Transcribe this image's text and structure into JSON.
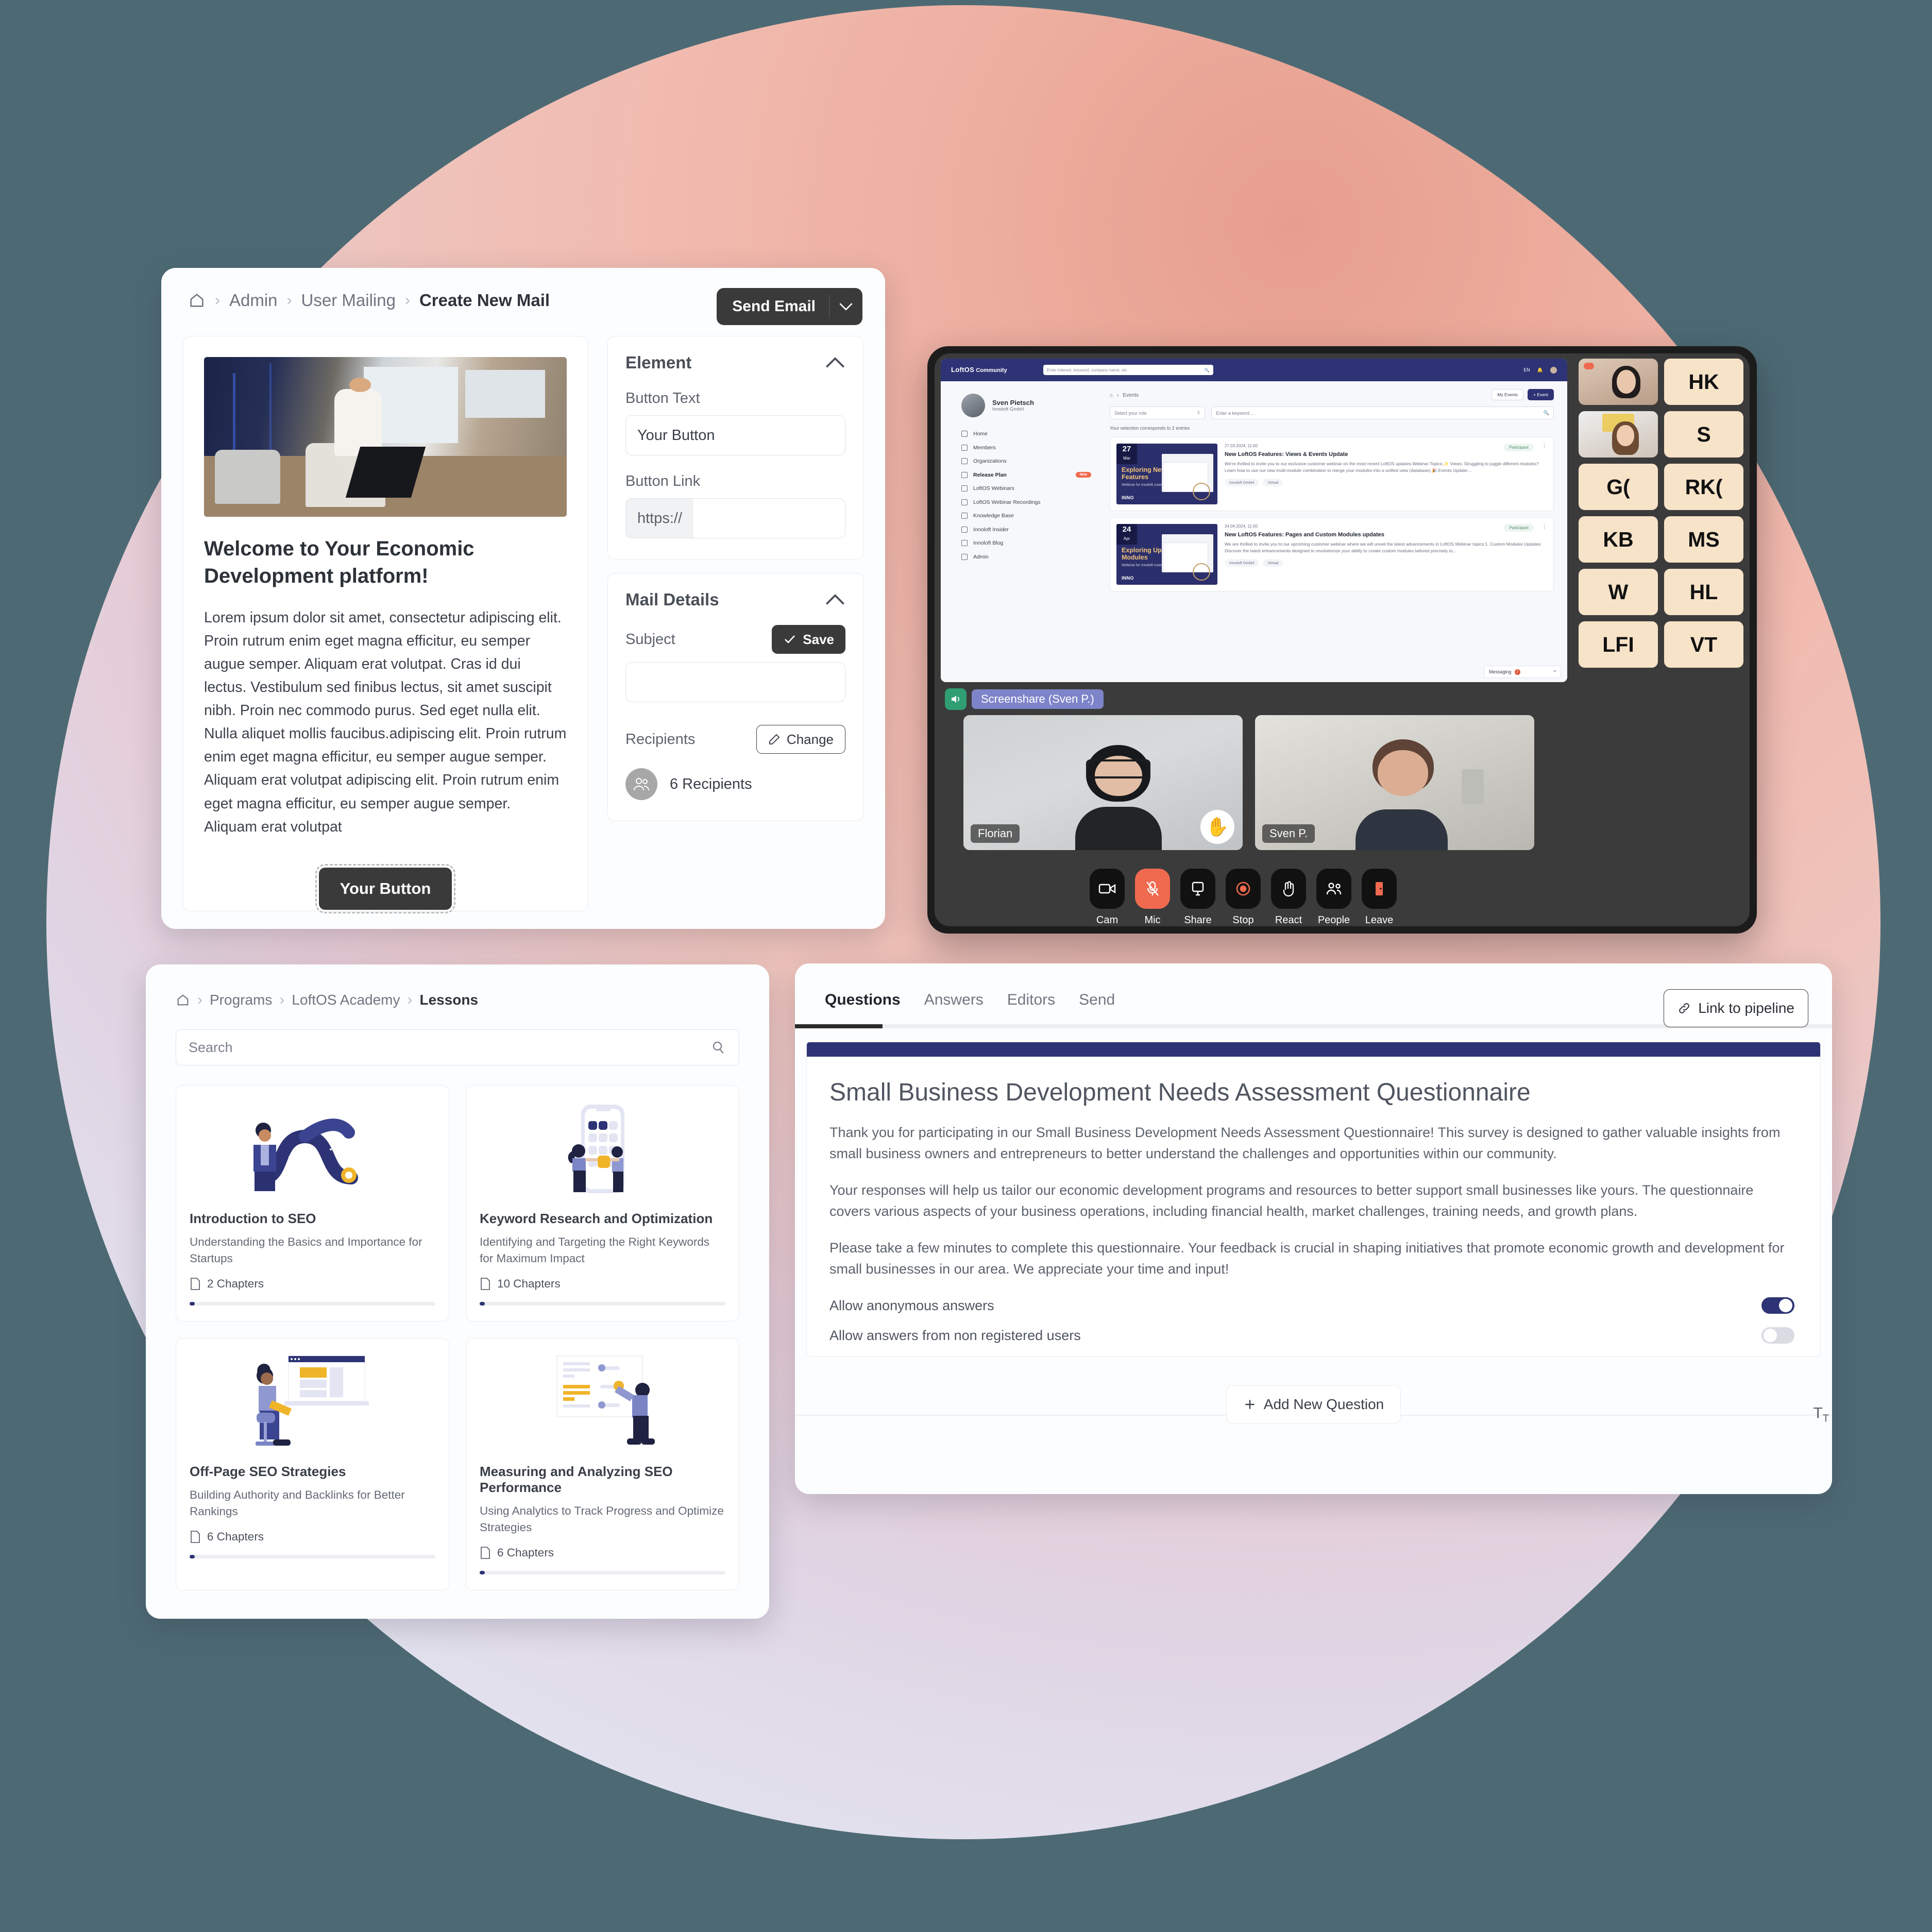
{
  "background": {
    "teal": "#4d6a74",
    "blob_pink": "#eeb0a2",
    "blob_lavender": "#e3e2ef"
  },
  "mail": {
    "breadcrumb": [
      "Admin",
      "User Mailing",
      "Create New Mail"
    ],
    "send_button": "Send Email",
    "preview": {
      "title": "Welcome to Your Economic Development platform!",
      "body": "Lorem ipsum dolor sit amet, consectetur adipiscing elit. Proin rutrum enim eget magna efficitur, eu semper augue semper. Aliquam erat volutpat. Cras id dui lectus. Vestibulum sed finibus lectus, sit amet suscipit nibh. Proin nec commodo purus. Sed eget nulla elit. Nulla aliquet mollis faucibus.adipiscing elit. Proin rutrum enim eget magna efficitur, eu semper augue semper. Aliquam erat volutpat adipiscing elit. Proin rutrum enim eget magna efficitur, eu semper augue semper. Aliquam erat volutpat",
      "button": "Your Button"
    },
    "element_panel": {
      "title": "Element",
      "button_text_label": "Button Text",
      "button_text_value": "Your Button",
      "button_link_label": "Button Link",
      "button_link_prefix": "https://",
      "button_link_value": ""
    },
    "mail_details_panel": {
      "title": "Mail Details",
      "subject_label": "Subject",
      "subject_value": "",
      "save_label": "Save",
      "recipients_label": "Recipients",
      "change_label": "Change",
      "recipients_count": "6 Recipients"
    }
  },
  "call": {
    "share_label": "Screenshare (Sven P.)",
    "tiles": [
      {
        "name": "Florian",
        "hand_raised": "✋"
      },
      {
        "name": "Sven P.",
        "hand_raised": ""
      }
    ],
    "controls": [
      {
        "label": "Cam",
        "icon": "camera-icon",
        "state": "off"
      },
      {
        "label": "Mic",
        "icon": "mic-muted-icon",
        "state": "muted"
      },
      {
        "label": "Share",
        "icon": "screen-share-icon",
        "state": "off"
      },
      {
        "label": "Stop",
        "icon": "record-stop-icon",
        "state": "off"
      },
      {
        "label": "React",
        "icon": "hand-raise-icon",
        "state": "off"
      },
      {
        "label": "People",
        "icon": "people-icon",
        "state": "off"
      },
      {
        "label": "Leave",
        "icon": "leave-door-icon",
        "state": "off"
      }
    ],
    "participants": [
      "",
      "HK",
      "",
      "S",
      "G(",
      "RK(",
      "KB",
      "MS",
      "W",
      "HL",
      "LFI",
      "VT"
    ],
    "shared_screen": {
      "brand_top": "LoftOS",
      "brand_bottom": "Community",
      "search_placeholder": "Enter interest, keyword, company name, etc.",
      "lang": "EN",
      "user_name": "Sven Pietsch",
      "user_org": "Innoloft GmbH",
      "nav": [
        {
          "label": "Home",
          "badge": ""
        },
        {
          "label": "Members",
          "badge": ""
        },
        {
          "label": "Organizations",
          "badge": ""
        },
        {
          "label": "Release Plan",
          "badge": "New"
        },
        {
          "label": "LoftOS Webinars",
          "badge": ""
        },
        {
          "label": "LoftOS Webinar Recordings",
          "badge": ""
        },
        {
          "label": "Knowledge Base",
          "badge": ""
        },
        {
          "label": "Innoloft Insider",
          "badge": ""
        },
        {
          "label": "Innoloft Blog",
          "badge": ""
        },
        {
          "label": "Admin",
          "badge": ""
        }
      ],
      "crumb": "Events",
      "my_events": "My Events",
      "add_event": "+ Event",
      "role_select": "Select your role",
      "keyword_placeholder": "Enter a keyword...",
      "result_count": "Your selection corresponds to 2 entries",
      "events": [
        {
          "day": "27",
          "month": "Mar",
          "thumb_title": "Exploring New LoftOS Features",
          "thumb_sub": "Webinar for Innoloft customers",
          "datetime": "27.03.2024, 11:00",
          "title": "New LoftOS Features: Views & Events Update",
          "text": "We're thrilled to invite you to our exclusive customer webinar on the most recent LoftOS updates.Webinar Topics:✨ Views: Struggling to juggle different modules? Learn how to use our new multi-module combination to merge your modules into a unified view (database).🎉 Events Update:...",
          "tags": [
            "Innoloft GmbH",
            "Virtual"
          ],
          "status": "Participant"
        },
        {
          "day": "24",
          "month": "Apr",
          "thumb_title": "Exploring Updated LoftOS Modules",
          "thumb_sub": "Webinar for Innoloft customers",
          "datetime": "24.04.2024, 11:00",
          "title": "New LoftOS Features: Pages and Custom Modules updates",
          "text": "We are thrilled to invite you to our upcoming customer webinar where we will unveil the latest advancements in LoftOS.Webinar topics:1. Custom Modules Updates: Discover the latest enhancements designed to revolutionize your ability to create custom modules tailored precisely to...",
          "tags": [
            "Innoloft GmbH",
            "Virtual"
          ],
          "status": "Participant"
        }
      ],
      "messaging": "Messaging",
      "messaging_badge": "2"
    }
  },
  "lessons": {
    "breadcrumb": [
      "Programs",
      "LoftOS Academy",
      "Lessons"
    ],
    "search_placeholder": "Search",
    "items": [
      {
        "title": "Introduction to SEO",
        "subtitle": "Understanding the Basics and Importance for Startups",
        "chapters": "2 Chapters",
        "art": "seo-journey-illustration"
      },
      {
        "title": "Keyword Research and Optimization",
        "subtitle": "Identifying and Targeting the Right Keywords for Maximum Impact",
        "chapters": "10 Chapters",
        "art": "mobile-apps-illustration"
      },
      {
        "title": "Off-Page SEO Strategies",
        "subtitle": "Building Authority and Backlinks for Better Rankings",
        "chapters": "6 Chapters",
        "art": "desk-laptop-illustration"
      },
      {
        "title": "Measuring and Analyzing SEO Performance",
        "subtitle": "Using Analytics to Track Progress and Optimize Strategies",
        "chapters": "6 Chapters",
        "art": "analytics-board-illustration"
      }
    ]
  },
  "questionnaire": {
    "tabs": [
      "Questions",
      "Answers",
      "Editors",
      "Send"
    ],
    "active_tab": "Questions",
    "link_button": "Link to pipeline",
    "title": "Small Business Development Needs Assessment Questionnaire",
    "paragraphs": [
      "Thank you for participating in our Small Business Development Needs Assessment Questionnaire! This survey is designed to gather valuable insights from small business owners and entrepreneurs to better understand the challenges and opportunities within our community.",
      "Your responses will help us tailor our economic development programs and resources to better support small businesses like yours. The questionnaire covers various aspects of your business operations, including financial health, market challenges, training needs, and growth plans.",
      "Please take a few minutes to complete this questionnaire. Your feedback is crucial in shaping initiatives that promote economic growth and development for small businesses in our area. We appreciate your time and input!"
    ],
    "toggles": [
      {
        "label": "Allow anonymous answers",
        "on": true
      },
      {
        "label": "Allow answers from non registered users",
        "on": false
      }
    ],
    "add_question": "Add New Question",
    "accent_color": "#2d3374"
  }
}
